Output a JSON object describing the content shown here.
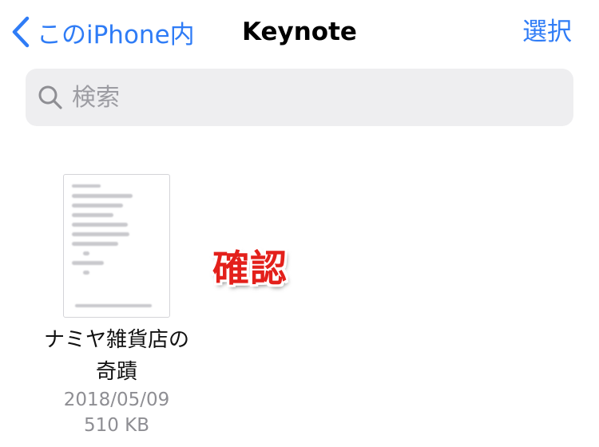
{
  "navbar": {
    "back_label": "このiPhone内",
    "title": "Keynote",
    "select_label": "選択"
  },
  "search": {
    "placeholder": "検索"
  },
  "files": [
    {
      "name_line1": "ナミヤ雑貨店の",
      "name_line2": "奇蹟",
      "date": "2018/05/09",
      "size": "510 KB"
    }
  ],
  "annotation": {
    "text": "確認",
    "color": "#e3201b"
  },
  "colors": {
    "accent": "#2f7cf6",
    "search_bg": "#eeeef0",
    "secondary_text": "#8e8e93"
  },
  "icons": {
    "back": "chevron-left-icon",
    "search": "magnifying-glass-icon",
    "thumbnail": "document-thumbnail"
  }
}
